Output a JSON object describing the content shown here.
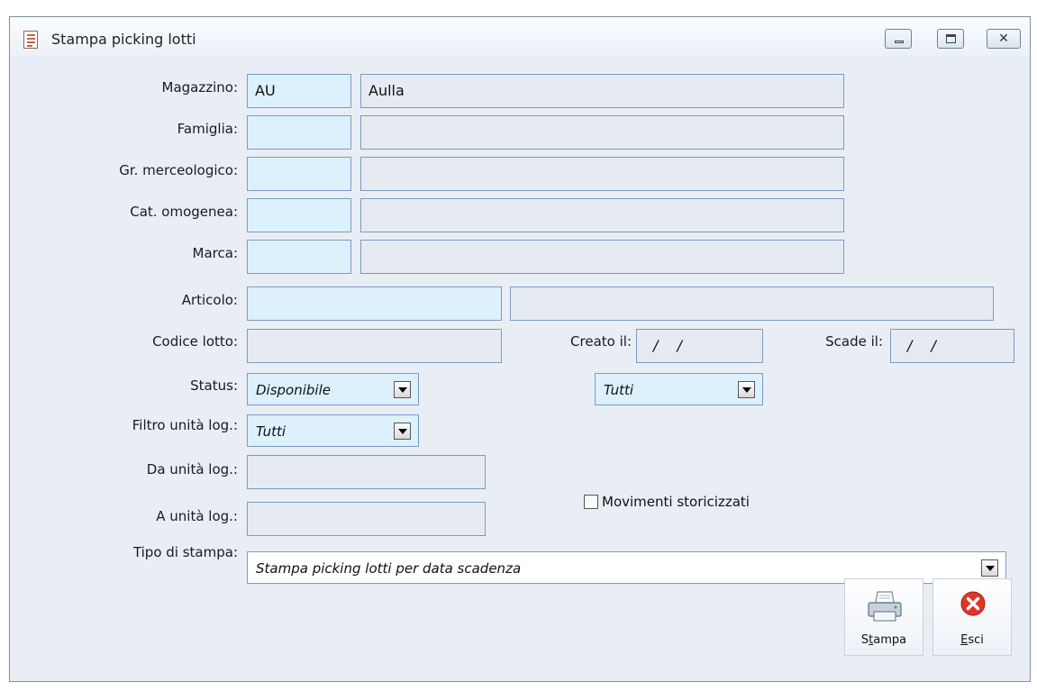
{
  "window": {
    "title": "Stampa picking lotti"
  },
  "labels": {
    "magazzino": "Magazzino:",
    "famiglia": "Famiglia:",
    "gruppo": "Gr. merceologico:",
    "categoria": "Cat. omogenea:",
    "marca": "Marca:",
    "articolo": "Articolo:",
    "codice_lotto": "Codice lotto:",
    "creato_il": "Creato il:",
    "scade_il": "Scade il:",
    "status": "Status:",
    "filtro_unita": "Filtro unità log.:",
    "da_unita": "Da unità log.:",
    "a_unita": "A unità log.:",
    "tipo_stampa": "Tipo di stampa:"
  },
  "values": {
    "magazzino_code": "AU",
    "magazzino_desc": "Aulla",
    "creato_il": "/ /",
    "scade_il": "/ /",
    "status": "Disponibile",
    "status2": "Tutti",
    "filtro_unita": "Tutti",
    "tipo_stampa": "Stampa picking lotti per data scadenza",
    "movimenti_checked": false
  },
  "checkbox": {
    "label": "Movimenti storicizzati"
  },
  "buttons": {
    "stampa_first": "S",
    "stampa_ul": "t",
    "stampa_rest": "ampa",
    "esci_ul": "E",
    "esci_rest": "sci"
  },
  "colors": {
    "field_code_bg": "#ddf1fc",
    "field_desc_bg": "#e6ebf2",
    "border": "#7a9bc4",
    "close_icon": "#e0352b"
  }
}
